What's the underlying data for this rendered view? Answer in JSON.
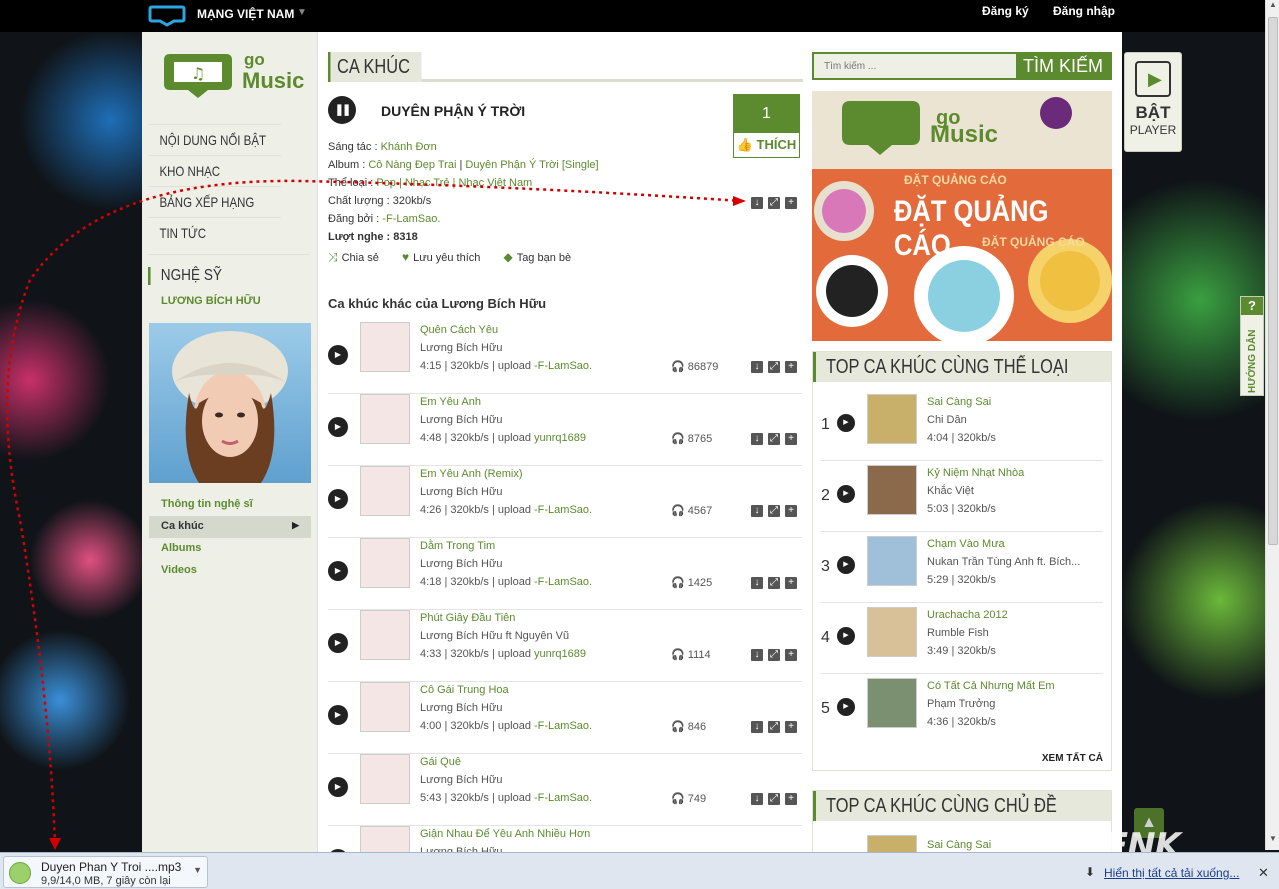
{
  "topbar": {
    "network": "MẠNG VIỆT NAM",
    "register": "Đăng ký",
    "login": "Đăng nhập"
  },
  "logo": {
    "line1": "go",
    "line2": "Music"
  },
  "nav": [
    {
      "label": "NỘI DUNG NỔI BẬT"
    },
    {
      "label": "KHO NHẠC"
    },
    {
      "label": "BẢNG XẾP HẠNG"
    },
    {
      "label": "TIN TỨC"
    }
  ],
  "artist": {
    "heading": "NGHỆ SỸ",
    "name": "LƯƠNG BÍCH HỮU"
  },
  "artist_menu": [
    {
      "label": "Thông tin nghệ sĩ",
      "active": false
    },
    {
      "label": "Ca khúc",
      "active": true
    },
    {
      "label": "Albums",
      "active": false
    },
    {
      "label": "Videos",
      "active": false
    }
  ],
  "main": {
    "section": "CA KHÚC",
    "song_title": "DUYÊN PHẬN Ý TRỜI",
    "likes": "1",
    "like_label": "THÍCH",
    "composer_label": "Sáng tác : ",
    "composer": "Khánh Đơn",
    "album_label": "Album : ",
    "album1": "Cô Nàng Đẹp Trai",
    "album_sep": " | ",
    "album2": "Duyên Phận Ý Trời [Single]",
    "genre_label": "Thể loại : ",
    "genre": "Pop | Nhạc Trẻ | Nhạc Việt Nam",
    "quality": "Chất lượng : 320kb/s",
    "uploader_label": "Đăng bởi : ",
    "uploader": "-F-LamSao.",
    "plays": "Lượt nghe : 8318",
    "share": "Chia sẻ",
    "favorite": "Lưu yêu thích",
    "tag": "Tag bạn bè",
    "other_title": "Ca khúc khác của Lương Bích Hữu"
  },
  "songs": [
    {
      "name": "Quên Cách Yêu",
      "artist": "Lương Bích Hữu",
      "duration": "4:15",
      "bitrate": "320kb/s",
      "uploader": "-F-LamSao.",
      "listens": "86879"
    },
    {
      "name": "Em Yêu Anh",
      "artist": "Lương Bích Hữu",
      "duration": "4:48",
      "bitrate": "320kb/s",
      "uploader": "yunrq1689",
      "listens": "8765"
    },
    {
      "name": "Em Yêu Anh (Remix)",
      "artist": "Lương Bích Hữu",
      "duration": "4:26",
      "bitrate": "320kb/s",
      "uploader": "-F-LamSao.",
      "listens": "4567"
    },
    {
      "name": "Dằm Trong Tim",
      "artist": "Lương Bích Hữu",
      "duration": "4:18",
      "bitrate": "320kb/s",
      "uploader": "-F-LamSao.",
      "listens": "1425"
    },
    {
      "name": "Phút Giây Đầu Tiên",
      "artist": "Lương Bích Hữu ft Nguyên Vũ",
      "duration": "4:33",
      "bitrate": "320kb/s",
      "uploader": "yunrq1689",
      "listens": "1114"
    },
    {
      "name": "Cô Gái Trung Hoa",
      "artist": "Lương Bích Hữu",
      "duration": "4:00",
      "bitrate": "320kb/s",
      "uploader": "-F-LamSao.",
      "listens": "846"
    },
    {
      "name": "Gái Quê",
      "artist": "Lương Bích Hữu",
      "duration": "5:43",
      "bitrate": "320kb/s",
      "uploader": "-F-LamSao.",
      "listens": "749"
    },
    {
      "name": "Giận Nhau Để Yêu Anh Nhiều Hơn",
      "artist": "Lương Bích Hữu",
      "duration": "",
      "bitrate": "",
      "uploader": "",
      "listens": ""
    }
  ],
  "search": {
    "placeholder": "Tìm kiếm ...",
    "button": "TÌM KIẾM"
  },
  "ad": {
    "line1": "ĐẶT QUẢNG CÁO",
    "line2": "ĐẶT QUẢNG CÁO",
    "line3": "ĐẶT QUẢNG CÁO"
  },
  "top_genre": {
    "title": "TOP CA KHÚC CÙNG THỂ LOẠI",
    "see_all": "XEM TẤT CẢ",
    "items": [
      {
        "rank": "1",
        "name": "Sai Càng Sai",
        "artist": "Chi Dân",
        "duration": "4:04",
        "bitrate": "320kb/s"
      },
      {
        "rank": "2",
        "name": "Kỷ Niệm Nhạt Nhòa",
        "artist": "Khắc Việt",
        "duration": "5:03",
        "bitrate": "320kb/s"
      },
      {
        "rank": "3",
        "name": "Chạm Vào Mưa",
        "artist": "Nukan Trần Tùng Anh ft. Bích...",
        "duration": "5:29",
        "bitrate": "320kb/s"
      },
      {
        "rank": "4",
        "name": "Urachacha 2012",
        "artist": "Rumble Fish",
        "duration": "3:49",
        "bitrate": "320kb/s"
      },
      {
        "rank": "5",
        "name": "Có Tất Cả Nhưng Mất Em",
        "artist": "Phạm Trưởng",
        "duration": "4:36",
        "bitrate": "320kb/s"
      }
    ]
  },
  "top_topic": {
    "title": "TOP CA KHÚC CÙNG CHỦ ĐỀ",
    "first": "Sai Càng Sai"
  },
  "player": {
    "line1": "BẬT",
    "line2": "PLAYER"
  },
  "guide": {
    "q": "?",
    "label": "HƯỚNG DẪN"
  },
  "download": {
    "file": "Duyen Phan Y Troi ....mp3",
    "status": "9,9/14,0 MB, 7 giây còn lại",
    "show_all": "Hiển thị tất cả tải xuống...",
    "progress": 0.707
  },
  "watermark": "GENK",
  "separators": {
    "bar": " | ",
    "upload": "upload "
  },
  "colors": {
    "accent": "#5c8a2e",
    "dotted": "#cc0000"
  }
}
